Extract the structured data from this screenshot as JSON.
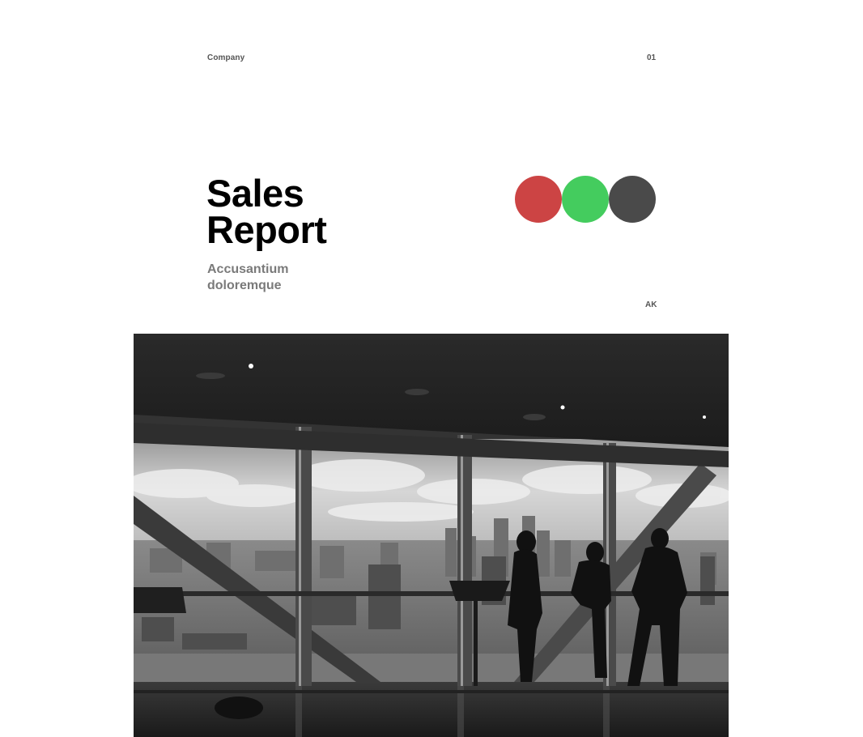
{
  "header": {
    "company": "Company",
    "page_number": "01"
  },
  "cover": {
    "title_line1": "Sales",
    "title_line2": "Report",
    "subtitle_line1": "Accusantium",
    "subtitle_line2": "doloremque",
    "initials": "AK"
  },
  "dots": [
    {
      "name": "red",
      "color": "#cc4444"
    },
    {
      "name": "green",
      "color": "#44cc5e"
    },
    {
      "name": "gray",
      "color": "#4a4a4a"
    }
  ],
  "photo": {
    "subject": "people-at-window-photo"
  }
}
